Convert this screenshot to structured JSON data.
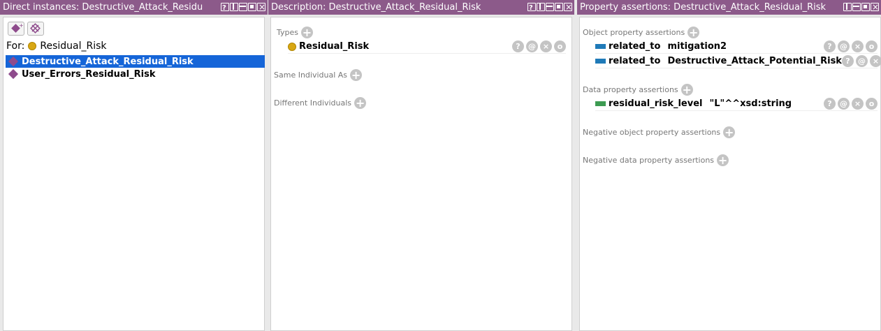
{
  "left_panel": {
    "title": "Direct instances: Destructive_Attack_Residu",
    "for_label": "For:",
    "class_name": "Residual_Risk",
    "instances": [
      {
        "label": "Destructive_Attack_Residual_Risk",
        "selected": true
      },
      {
        "label": "User_Errors_Residual_Risk",
        "selected": false
      }
    ]
  },
  "description_panel": {
    "title": "Description: Destructive_Attack_Residual_Risk",
    "types_label": "Types",
    "type_value": "Residual_Risk",
    "same_individual_label": "Same Individual As",
    "different_individuals_label": "Different Individuals"
  },
  "property_panel": {
    "title": "Property assertions: Destructive_Attack_Residual_Risk",
    "object_property_label": "Object property assertions",
    "object_assertions": [
      {
        "property": "related_to",
        "value": "mitigation2"
      },
      {
        "property": "related_to",
        "value": "Destructive_Attack_Potential_Risk"
      }
    ],
    "data_property_label": "Data property assertions",
    "data_assertions": [
      {
        "property": "residual_risk_level",
        "value": "\"L\"^^xsd:string"
      }
    ],
    "negative_object_label": "Negative object property assertions",
    "negative_data_label": "Negative data property assertions"
  },
  "row_icons": [
    "?",
    "@",
    "×",
    "o"
  ],
  "colors": {
    "header": "#8c5a8a",
    "selection": "#1565d8",
    "individual": "#8e4b8c",
    "class_dot": "#d8a713",
    "object_prop": "#1f7ab8",
    "data_prop": "#3d9b52"
  }
}
